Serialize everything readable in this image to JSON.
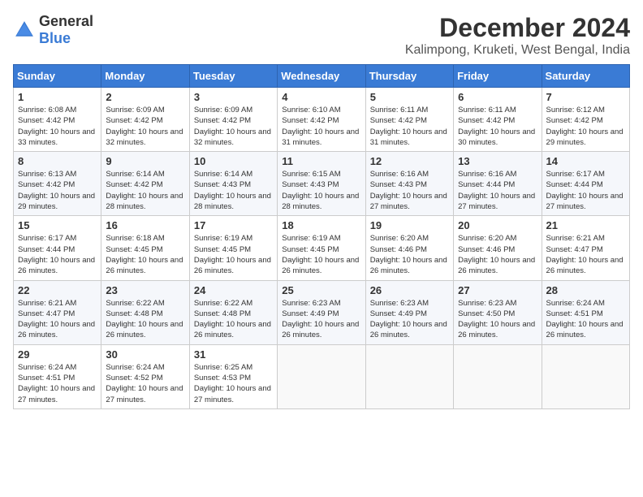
{
  "header": {
    "logo_general": "General",
    "logo_blue": "Blue",
    "title": "December 2024",
    "subtitle": "Kalimpong, Kruketi, West Bengal, India"
  },
  "weekdays": [
    "Sunday",
    "Monday",
    "Tuesday",
    "Wednesday",
    "Thursday",
    "Friday",
    "Saturday"
  ],
  "weeks": [
    [
      {
        "day": "1",
        "sunrise": "6:08 AM",
        "sunset": "4:42 PM",
        "daylight": "10 hours and 33 minutes."
      },
      {
        "day": "2",
        "sunrise": "6:09 AM",
        "sunset": "4:42 PM",
        "daylight": "10 hours and 32 minutes."
      },
      {
        "day": "3",
        "sunrise": "6:09 AM",
        "sunset": "4:42 PM",
        "daylight": "10 hours and 32 minutes."
      },
      {
        "day": "4",
        "sunrise": "6:10 AM",
        "sunset": "4:42 PM",
        "daylight": "10 hours and 31 minutes."
      },
      {
        "day": "5",
        "sunrise": "6:11 AM",
        "sunset": "4:42 PM",
        "daylight": "10 hours and 31 minutes."
      },
      {
        "day": "6",
        "sunrise": "6:11 AM",
        "sunset": "4:42 PM",
        "daylight": "10 hours and 30 minutes."
      },
      {
        "day": "7",
        "sunrise": "6:12 AM",
        "sunset": "4:42 PM",
        "daylight": "10 hours and 29 minutes."
      }
    ],
    [
      {
        "day": "8",
        "sunrise": "6:13 AM",
        "sunset": "4:42 PM",
        "daylight": "10 hours and 29 minutes."
      },
      {
        "day": "9",
        "sunrise": "6:14 AM",
        "sunset": "4:42 PM",
        "daylight": "10 hours and 28 minutes."
      },
      {
        "day": "10",
        "sunrise": "6:14 AM",
        "sunset": "4:43 PM",
        "daylight": "10 hours and 28 minutes."
      },
      {
        "day": "11",
        "sunrise": "6:15 AM",
        "sunset": "4:43 PM",
        "daylight": "10 hours and 28 minutes."
      },
      {
        "day": "12",
        "sunrise": "6:16 AM",
        "sunset": "4:43 PM",
        "daylight": "10 hours and 27 minutes."
      },
      {
        "day": "13",
        "sunrise": "6:16 AM",
        "sunset": "4:44 PM",
        "daylight": "10 hours and 27 minutes."
      },
      {
        "day": "14",
        "sunrise": "6:17 AM",
        "sunset": "4:44 PM",
        "daylight": "10 hours and 27 minutes."
      }
    ],
    [
      {
        "day": "15",
        "sunrise": "6:17 AM",
        "sunset": "4:44 PM",
        "daylight": "10 hours and 26 minutes."
      },
      {
        "day": "16",
        "sunrise": "6:18 AM",
        "sunset": "4:45 PM",
        "daylight": "10 hours and 26 minutes."
      },
      {
        "day": "17",
        "sunrise": "6:19 AM",
        "sunset": "4:45 PM",
        "daylight": "10 hours and 26 minutes."
      },
      {
        "day": "18",
        "sunrise": "6:19 AM",
        "sunset": "4:45 PM",
        "daylight": "10 hours and 26 minutes."
      },
      {
        "day": "19",
        "sunrise": "6:20 AM",
        "sunset": "4:46 PM",
        "daylight": "10 hours and 26 minutes."
      },
      {
        "day": "20",
        "sunrise": "6:20 AM",
        "sunset": "4:46 PM",
        "daylight": "10 hours and 26 minutes."
      },
      {
        "day": "21",
        "sunrise": "6:21 AM",
        "sunset": "4:47 PM",
        "daylight": "10 hours and 26 minutes."
      }
    ],
    [
      {
        "day": "22",
        "sunrise": "6:21 AM",
        "sunset": "4:47 PM",
        "daylight": "10 hours and 26 minutes."
      },
      {
        "day": "23",
        "sunrise": "6:22 AM",
        "sunset": "4:48 PM",
        "daylight": "10 hours and 26 minutes."
      },
      {
        "day": "24",
        "sunrise": "6:22 AM",
        "sunset": "4:48 PM",
        "daylight": "10 hours and 26 minutes."
      },
      {
        "day": "25",
        "sunrise": "6:23 AM",
        "sunset": "4:49 PM",
        "daylight": "10 hours and 26 minutes."
      },
      {
        "day": "26",
        "sunrise": "6:23 AM",
        "sunset": "4:49 PM",
        "daylight": "10 hours and 26 minutes."
      },
      {
        "day": "27",
        "sunrise": "6:23 AM",
        "sunset": "4:50 PM",
        "daylight": "10 hours and 26 minutes."
      },
      {
        "day": "28",
        "sunrise": "6:24 AM",
        "sunset": "4:51 PM",
        "daylight": "10 hours and 26 minutes."
      }
    ],
    [
      {
        "day": "29",
        "sunrise": "6:24 AM",
        "sunset": "4:51 PM",
        "daylight": "10 hours and 27 minutes."
      },
      {
        "day": "30",
        "sunrise": "6:24 AM",
        "sunset": "4:52 PM",
        "daylight": "10 hours and 27 minutes."
      },
      {
        "day": "31",
        "sunrise": "6:25 AM",
        "sunset": "4:53 PM",
        "daylight": "10 hours and 27 minutes."
      },
      null,
      null,
      null,
      null
    ]
  ]
}
